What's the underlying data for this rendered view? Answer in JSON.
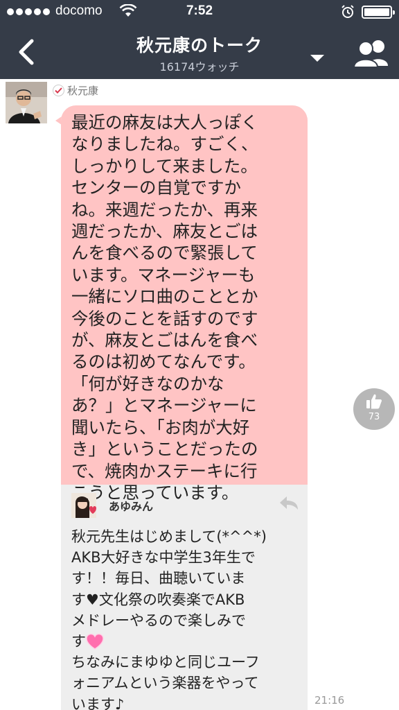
{
  "status": {
    "carrier": "docomo",
    "time": "7:52"
  },
  "header": {
    "title": "秋元康のトーク",
    "watch_count": "16174ウォッチ"
  },
  "post": {
    "sender": "秋元康",
    "message_lines": [
      "最近の麻友は大人っぽく",
      "なりましたね。すごく、",
      "しっかりして来ました。",
      "センターの自覚ですか",
      "ね。来週だったか、再来",
      "週だったか、麻友とごは",
      "んを食べるので緊張して",
      "います。マネージャーも",
      "一緒にソロ曲のこととか",
      "今後のことを話すのです",
      "が、麻友とごはんを食べ",
      "るのは初めてなんです。",
      "「何が好きなのかな",
      "あ？」とマネージャーに",
      "聞いたら、「お肉が大好",
      "き」ということだったの",
      "で、焼肉かステーキに行",
      "こうと思っています。"
    ],
    "likes": "73",
    "time": "21:16"
  },
  "reply": {
    "name": "あゆみん",
    "lines": [
      "秋元先生はじめまして(*^^*)",
      "AKB大好きな中学生3年生で",
      "す！！毎日、曲聴いていま",
      "す♥文化祭の吹奏楽でAKB",
      "メドレーやるので楽しみで",
      "す",
      "ちなみにまゆゆと同じユーフ",
      "ォニアムという楽器をやって",
      "います♪"
    ]
  },
  "colors": {
    "header_bg": "#353c48",
    "message_bg": "#ffc4c4",
    "reply_bg": "#eeeeee",
    "like_bg": "#b7b7b7"
  }
}
